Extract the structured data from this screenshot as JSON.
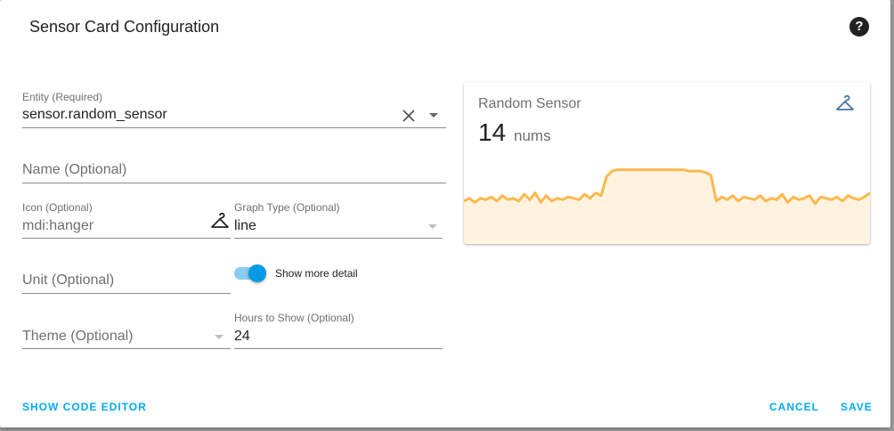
{
  "dialog": {
    "title": "Sensor Card Configuration",
    "help_icon": "help-circle-icon"
  },
  "form": {
    "entity": {
      "label": "Entity (Required)",
      "value": "sensor.random_sensor"
    },
    "name": {
      "placeholder": "Name (Optional)"
    },
    "icon": {
      "label": "Icon (Optional)",
      "value": "mdi:hanger",
      "icon": "hanger-icon"
    },
    "graph_type": {
      "label": "Graph Type (Optional)",
      "value": "line"
    },
    "unit": {
      "placeholder": "Unit (Optional)"
    },
    "show_more_detail": {
      "label": "Show more detail",
      "checked": true
    },
    "theme": {
      "placeholder": "Theme (Optional)"
    },
    "hours_to_show": {
      "label": "Hours to Show (Optional)",
      "value": "24"
    }
  },
  "preview": {
    "name": "Random Sensor",
    "value": "14",
    "unit": "nums",
    "icon": "hanger-icon",
    "graph": {
      "color": "#ffb74d",
      "fill": "#fff3e0",
      "values": [
        8,
        10,
        7,
        10,
        9,
        11,
        8,
        12,
        9,
        10,
        8,
        13,
        9,
        14,
        7,
        12,
        8,
        10,
        9,
        11,
        10,
        9,
        13,
        10,
        14,
        12,
        26,
        30,
        31,
        31,
        31,
        31,
        31,
        31,
        31,
        31,
        31,
        31,
        31,
        31,
        31,
        30,
        30,
        30,
        29,
        27,
        8,
        11,
        9,
        12,
        8,
        11,
        10,
        9,
        12,
        8,
        10,
        9,
        13,
        7,
        11,
        9,
        10,
        12,
        6,
        11,
        10,
        9,
        11,
        8,
        12,
        10,
        9,
        11,
        14
      ]
    }
  },
  "actions": {
    "show_code_editor": "SHOW CODE EDITOR",
    "cancel": "CANCEL",
    "save": "SAVE"
  },
  "colors": {
    "accent": "#03a9f4",
    "toggle": "#039be5",
    "graph_line": "#ffb74d",
    "graph_fill": "#fff3e0",
    "card_icon": "#44739e"
  }
}
